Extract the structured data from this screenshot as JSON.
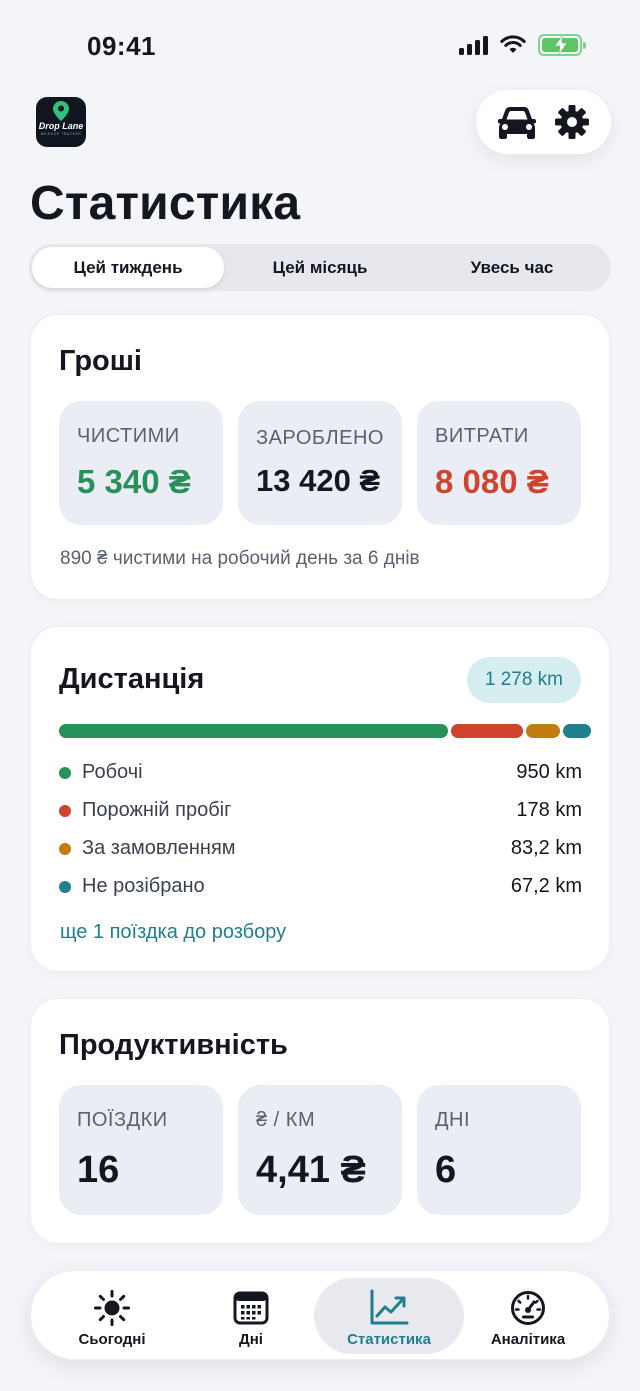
{
  "status": {
    "time": "09:41"
  },
  "app": {
    "logo_text": "Drop Lane",
    "logo_sub": "MILEAGE TRACKER"
  },
  "header": {
    "title": "Статистика"
  },
  "periods": [
    {
      "label": "Цей тиждень",
      "active": true
    },
    {
      "label": "Цей місяць",
      "active": false
    },
    {
      "label": "Увесь час",
      "active": false
    }
  ],
  "money": {
    "title": "Гроші",
    "net": {
      "label": "ЧИСТИМИ",
      "value": "5 340 ₴",
      "color": "#27915a"
    },
    "earned": {
      "label": "ЗАРОБЛЕНО",
      "value": "13 420 ₴",
      "color": "#14171f"
    },
    "expenses": {
      "label": "ВИТРАТИ",
      "value": "8 080 ₴",
      "color": "#d0432f"
    },
    "note": "890 ₴ чистими на робочий день за 6 днів"
  },
  "distance": {
    "title": "Дистанція",
    "total": "1 278 km",
    "items": [
      {
        "label": "Робочі",
        "value": "950 km",
        "km": 950,
        "color": "#27915a"
      },
      {
        "label": "Порожній пробіг",
        "value": "178 km",
        "km": 178,
        "color": "#d0432f"
      },
      {
        "label": "За замовленням",
        "value": "83,2 km",
        "km": 83.2,
        "color": "#c27c10"
      },
      {
        "label": "Не розібрано",
        "value": "67,2 km",
        "km": 67.2,
        "color": "#1f7f8c"
      }
    ],
    "link": "ще 1 поїздка до розбору"
  },
  "productivity": {
    "title": "Продуктивність",
    "trips": {
      "label": "ПОЇЗДКИ",
      "value": "16"
    },
    "per_km": {
      "label": "₴ / КМ",
      "value": "4,41 ₴"
    },
    "days": {
      "label": "ДНІ",
      "value": "6"
    }
  },
  "tabs": [
    {
      "label": "Сьогодні",
      "icon": "sun-icon",
      "active": false
    },
    {
      "label": "Дні",
      "icon": "calendar-icon",
      "active": false
    },
    {
      "label": "Статистика",
      "icon": "chart-icon",
      "active": true
    },
    {
      "label": "Аналітика",
      "icon": "speedometer-icon",
      "active": false
    }
  ],
  "colors": {
    "accent": "#1f7f8c",
    "positive": "#27915a",
    "negative": "#d0432f"
  }
}
